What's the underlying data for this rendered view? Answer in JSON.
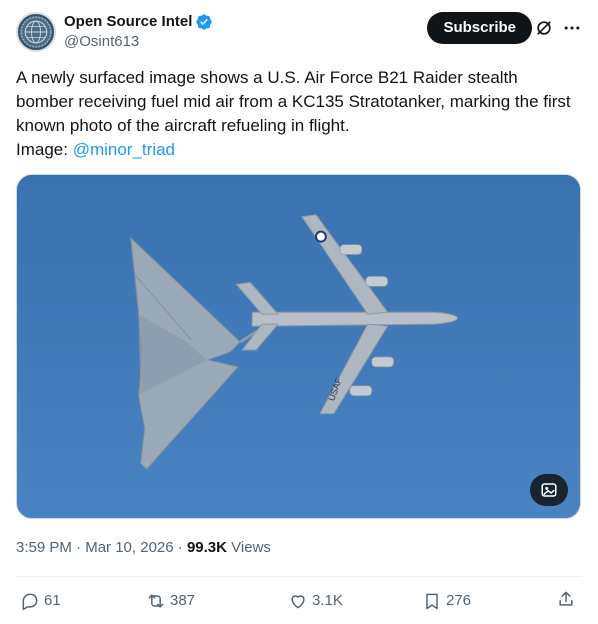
{
  "author": {
    "display_name": "Open Source Intel",
    "handle": "@Osint613",
    "avatar_icon": "globe-emblem-avatar",
    "verified_icon": "verified-badge-icon",
    "verified_color": "#1d9bf0"
  },
  "header": {
    "subscribe_label": "Subscribe",
    "grok_icon": "grok-icon",
    "more_icon": "more-icon"
  },
  "tweet": {
    "text": "A newly surfaced image shows a U.S. Air Force B21 Raider stealth bomber receiving fuel mid air from a KC135 Stratotanker, marking the first known photo of the aircraft refueling in flight.",
    "image_prefix": "Image: ",
    "mention": "@minor_triad"
  },
  "media": {
    "sky_color": "#3f78b6",
    "tail_marking": "USAF",
    "alt_icon": "alt-text-icon"
  },
  "meta": {
    "time": "3:59 PM",
    "separator": "·",
    "date": "Mar 10, 2026",
    "views_count": "99.3K",
    "views_label": "Views"
  },
  "actions": {
    "replies": "61",
    "reposts": "387",
    "likes": "3.1K",
    "bookmarks": "276",
    "share_icon": "share-icon"
  }
}
